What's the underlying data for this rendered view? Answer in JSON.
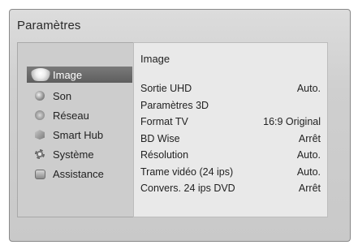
{
  "screen": {
    "title": "Paramètres"
  },
  "menu": {
    "items": [
      {
        "label": "Image",
        "icon": "image-icon",
        "active": true
      },
      {
        "label": "Son",
        "icon": "speaker-icon"
      },
      {
        "label": "Réseau",
        "icon": "globe-icon"
      },
      {
        "label": "Smart Hub",
        "icon": "smart-hub-icon"
      },
      {
        "label": "Système",
        "icon": "gear-icon"
      },
      {
        "label": "Assistance",
        "icon": "chat-icon"
      }
    ]
  },
  "submenu": {
    "title": "Image",
    "rows": [
      {
        "label": "Sortie UHD",
        "value": "Auto."
      },
      {
        "label": "Paramètres 3D",
        "value": ""
      },
      {
        "label": "Format TV",
        "value": "16:9 Original"
      },
      {
        "label": "BD Wise",
        "value": "Arrêt"
      },
      {
        "label": "Résolution",
        "value": "Auto."
      },
      {
        "label": "Trame vidéo (24 ips)",
        "value": "Auto."
      },
      {
        "label": "Convers. 24 ips DVD",
        "value": "Arrêt"
      }
    ]
  }
}
